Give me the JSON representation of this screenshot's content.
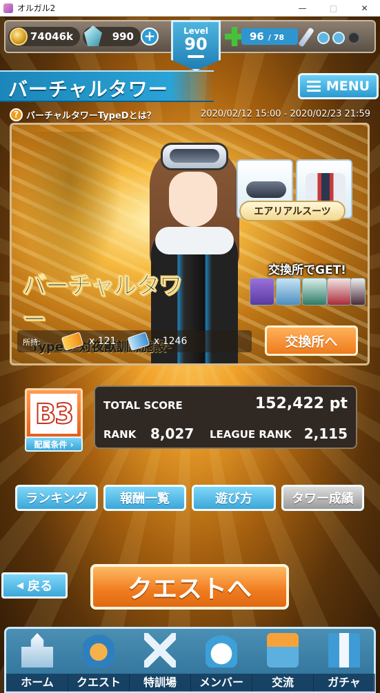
{
  "window": {
    "title": "オルガル2",
    "minimize": "—",
    "maximize": "□",
    "close": "✕"
  },
  "hud": {
    "gold": "74046k",
    "gems": "990",
    "level_label": "Level",
    "level": "90",
    "stamina_current": "96",
    "stamina_max": "/ 78",
    "colors": {
      "hud_bg": "#5b5046",
      "stamina": "#2f95cf",
      "level": "#1f7fb5"
    }
  },
  "header": {
    "title": "バーチャルタワー",
    "menu_label": "MENU"
  },
  "info": {
    "help_icon": "?",
    "help_text": "バーチャルタワーTypeDとは？",
    "period": "2020/02/12 15:00 - 2020/02/23 21:59"
  },
  "banner": {
    "reward_label": "エアリアルスーツ",
    "exchange_get": "交換所でGET!",
    "logo_title": "バーチャルタワー",
    "logo_subtitle": "TypeD-対夜獣訓練施設-",
    "holdings_label": "所持:",
    "ticket1_count": "x 121",
    "ticket2_count": "x 1246",
    "exchange_button": "交換所へ"
  },
  "score": {
    "league_badge": "B3",
    "assign_conditions": "配属条件 ›",
    "total_score_label": "TOTAL SCORE",
    "total_score_value": "152,422 pt",
    "rank_label": "RANK",
    "rank_value": "8,027",
    "league_rank_label": "LEAGUE RANK",
    "league_rank_value": "2,115"
  },
  "tabs": [
    {
      "label": "ランキング"
    },
    {
      "label": "報酬一覧"
    },
    {
      "label": "遊び方"
    },
    {
      "label": "タワー成績"
    }
  ],
  "actions": {
    "back_label": "戻る",
    "back_icon": "◀",
    "quest_label": "クエストへ"
  },
  "nav": [
    {
      "label": "ホーム",
      "icon": "castle-icon"
    },
    {
      "label": "クエスト",
      "icon": "dragon-icon"
    },
    {
      "label": "特訓場",
      "icon": "crossed-swords-icon"
    },
    {
      "label": "メンバー",
      "icon": "cat-girl-icon"
    },
    {
      "label": "交流",
      "icon": "map-icon"
    },
    {
      "label": "ガチャ",
      "icon": "curtain-icon"
    }
  ]
}
